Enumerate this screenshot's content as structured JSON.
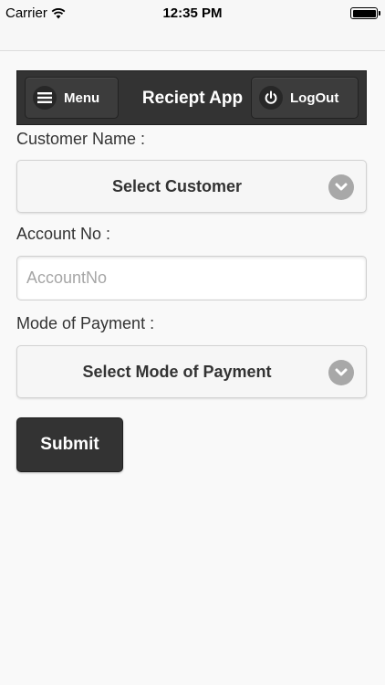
{
  "status_bar": {
    "carrier": "Carrier",
    "time": "12:35 PM"
  },
  "header": {
    "title": "Reciept App",
    "menu_label": "Menu",
    "menu_icon": "hamburger-icon",
    "logout_label": "LogOut",
    "logout_icon": "power-icon"
  },
  "form": {
    "customer_label": "Customer Name :",
    "customer_select": "Select Customer",
    "account_label": "Account No :",
    "account_placeholder": "AccountNo",
    "account_value": "",
    "payment_label": "Mode of Payment :",
    "payment_select": "Select Mode of Payment",
    "submit_label": "Submit"
  },
  "colors": {
    "header_bg": "#333333",
    "page_bg": "#f9f9f9",
    "chevron_bg": "#a8a8a8"
  }
}
